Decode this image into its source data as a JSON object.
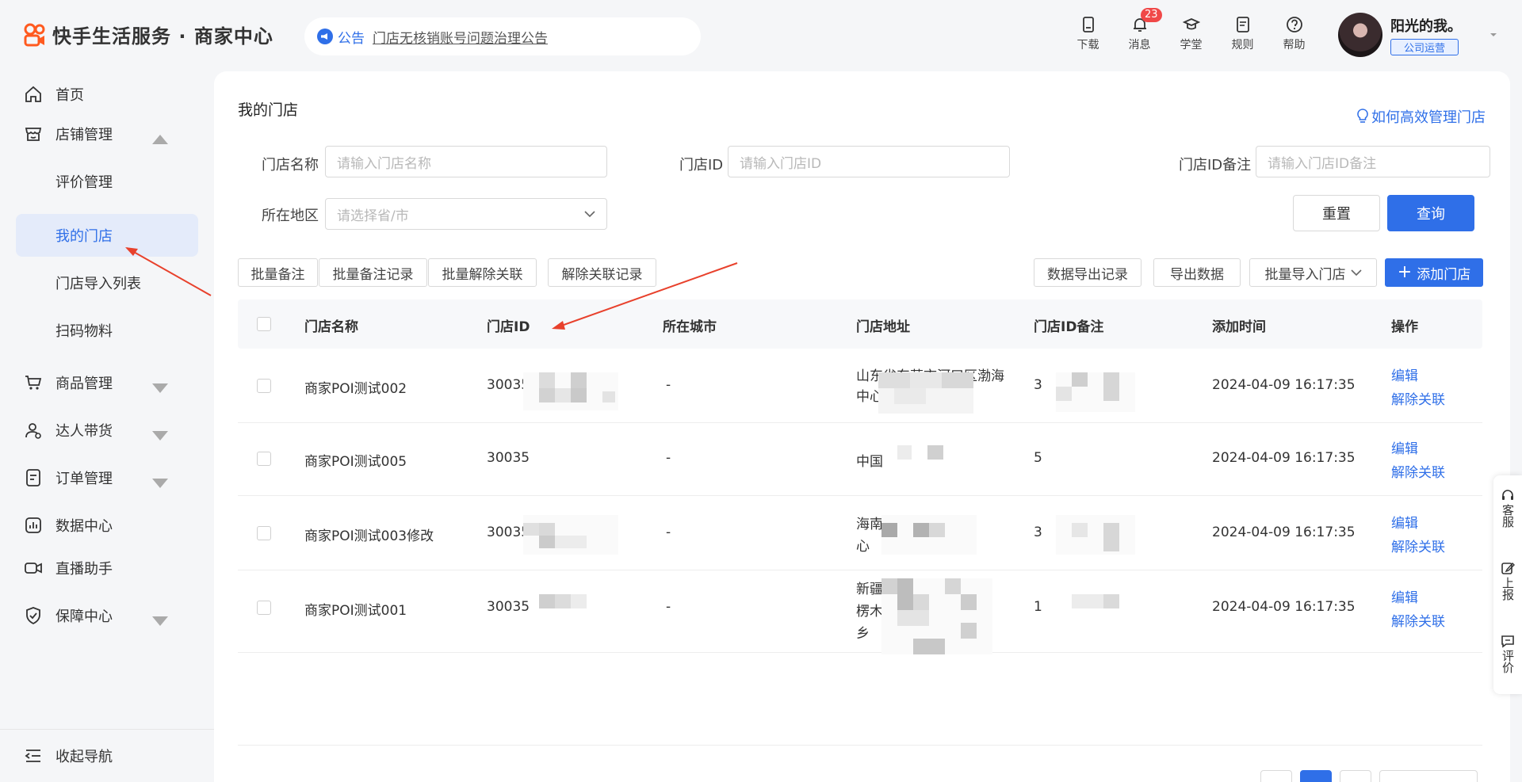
{
  "header": {
    "logo_text": "快手生活服务 · 商家中心",
    "notice_tag": "公告",
    "notice_text": "门店无核销账号问题治理公告",
    "tools": [
      {
        "label": "下载",
        "icon": "download-icon"
      },
      {
        "label": "消息",
        "icon": "bell-icon",
        "badge": "23"
      },
      {
        "label": "学堂",
        "icon": "graduation-cap-icon"
      },
      {
        "label": "规则",
        "icon": "document-icon"
      },
      {
        "label": "帮助",
        "icon": "help-circle-icon"
      }
    ],
    "user_name": "阳光的我。",
    "user_role": "公司运营"
  },
  "sidebar": {
    "home": "首页",
    "store_mgmt": "店铺管理",
    "sub_items": [
      "评价管理",
      "我的门店",
      "门店导入列表",
      "扫码物料"
    ],
    "goods": "商品管理",
    "talent": "达人带货",
    "orders": "订单管理",
    "data": "数据中心",
    "live": "直播助手",
    "guarantee": "保障中心",
    "collapse": "收起导航"
  },
  "page": {
    "title": "我的门店",
    "help_link": "如何高效管理门店"
  },
  "filters": {
    "name_label": "门店名称",
    "name_placeholder": "请输入门店名称",
    "id_label": "门店ID",
    "id_placeholder": "请输入门店ID",
    "remark_label": "门店ID备注",
    "remark_placeholder": "请输入门店ID备注",
    "region_label": "所在地区",
    "region_placeholder": "请选择省/市",
    "reset": "重置",
    "query": "查询"
  },
  "toolbar": {
    "batch_remark": "批量备注",
    "batch_remark_log": "批量备注记录",
    "batch_unlink": "批量解除关联",
    "unlink_log": "解除关联记录",
    "export_log": "数据导出记录",
    "export": "导出数据",
    "batch_import": "批量导入门店",
    "add_store": "添加门店"
  },
  "table": {
    "columns": [
      "门店名称",
      "门店ID",
      "所在城市",
      "门店地址",
      "门店ID备注",
      "添加时间",
      "操作"
    ],
    "rows": [
      {
        "name": "商家POI测试002",
        "id": "30035",
        "city": "-",
        "address": "山东省东营市河口区渤海中心",
        "remark": "3",
        "time": "2024-04-09 16:17:35"
      },
      {
        "name": "商家POI测试005",
        "id": "30035",
        "city": "-",
        "address": "中国",
        "remark": "5",
        "time": "2024-04-09 16:17:35"
      },
      {
        "name": "商家POI测试003修改",
        "id": "30035",
        "city": "-",
        "address": "海南心",
        "remark": "3",
        "time": "2024-04-09 16:17:35"
      },
      {
        "name": "商家POI测试001",
        "id": "30035",
        "city": "-",
        "address": "新疆楞木乡",
        "remark": "1",
        "time": "2024-04-09 16:17:35"
      }
    ],
    "edit": "编辑",
    "unlink": "解除关联"
  },
  "float_tools": [
    {
      "label": "客服",
      "icon": "headset-icon"
    },
    {
      "label": "上报",
      "icon": "edit-report-icon"
    },
    {
      "label": "评价",
      "icon": "comment-icon"
    }
  ],
  "colors": {
    "accent": "#2f6fe8",
    "annotation_arrow": "#e8412c",
    "badge": "#f04848"
  }
}
